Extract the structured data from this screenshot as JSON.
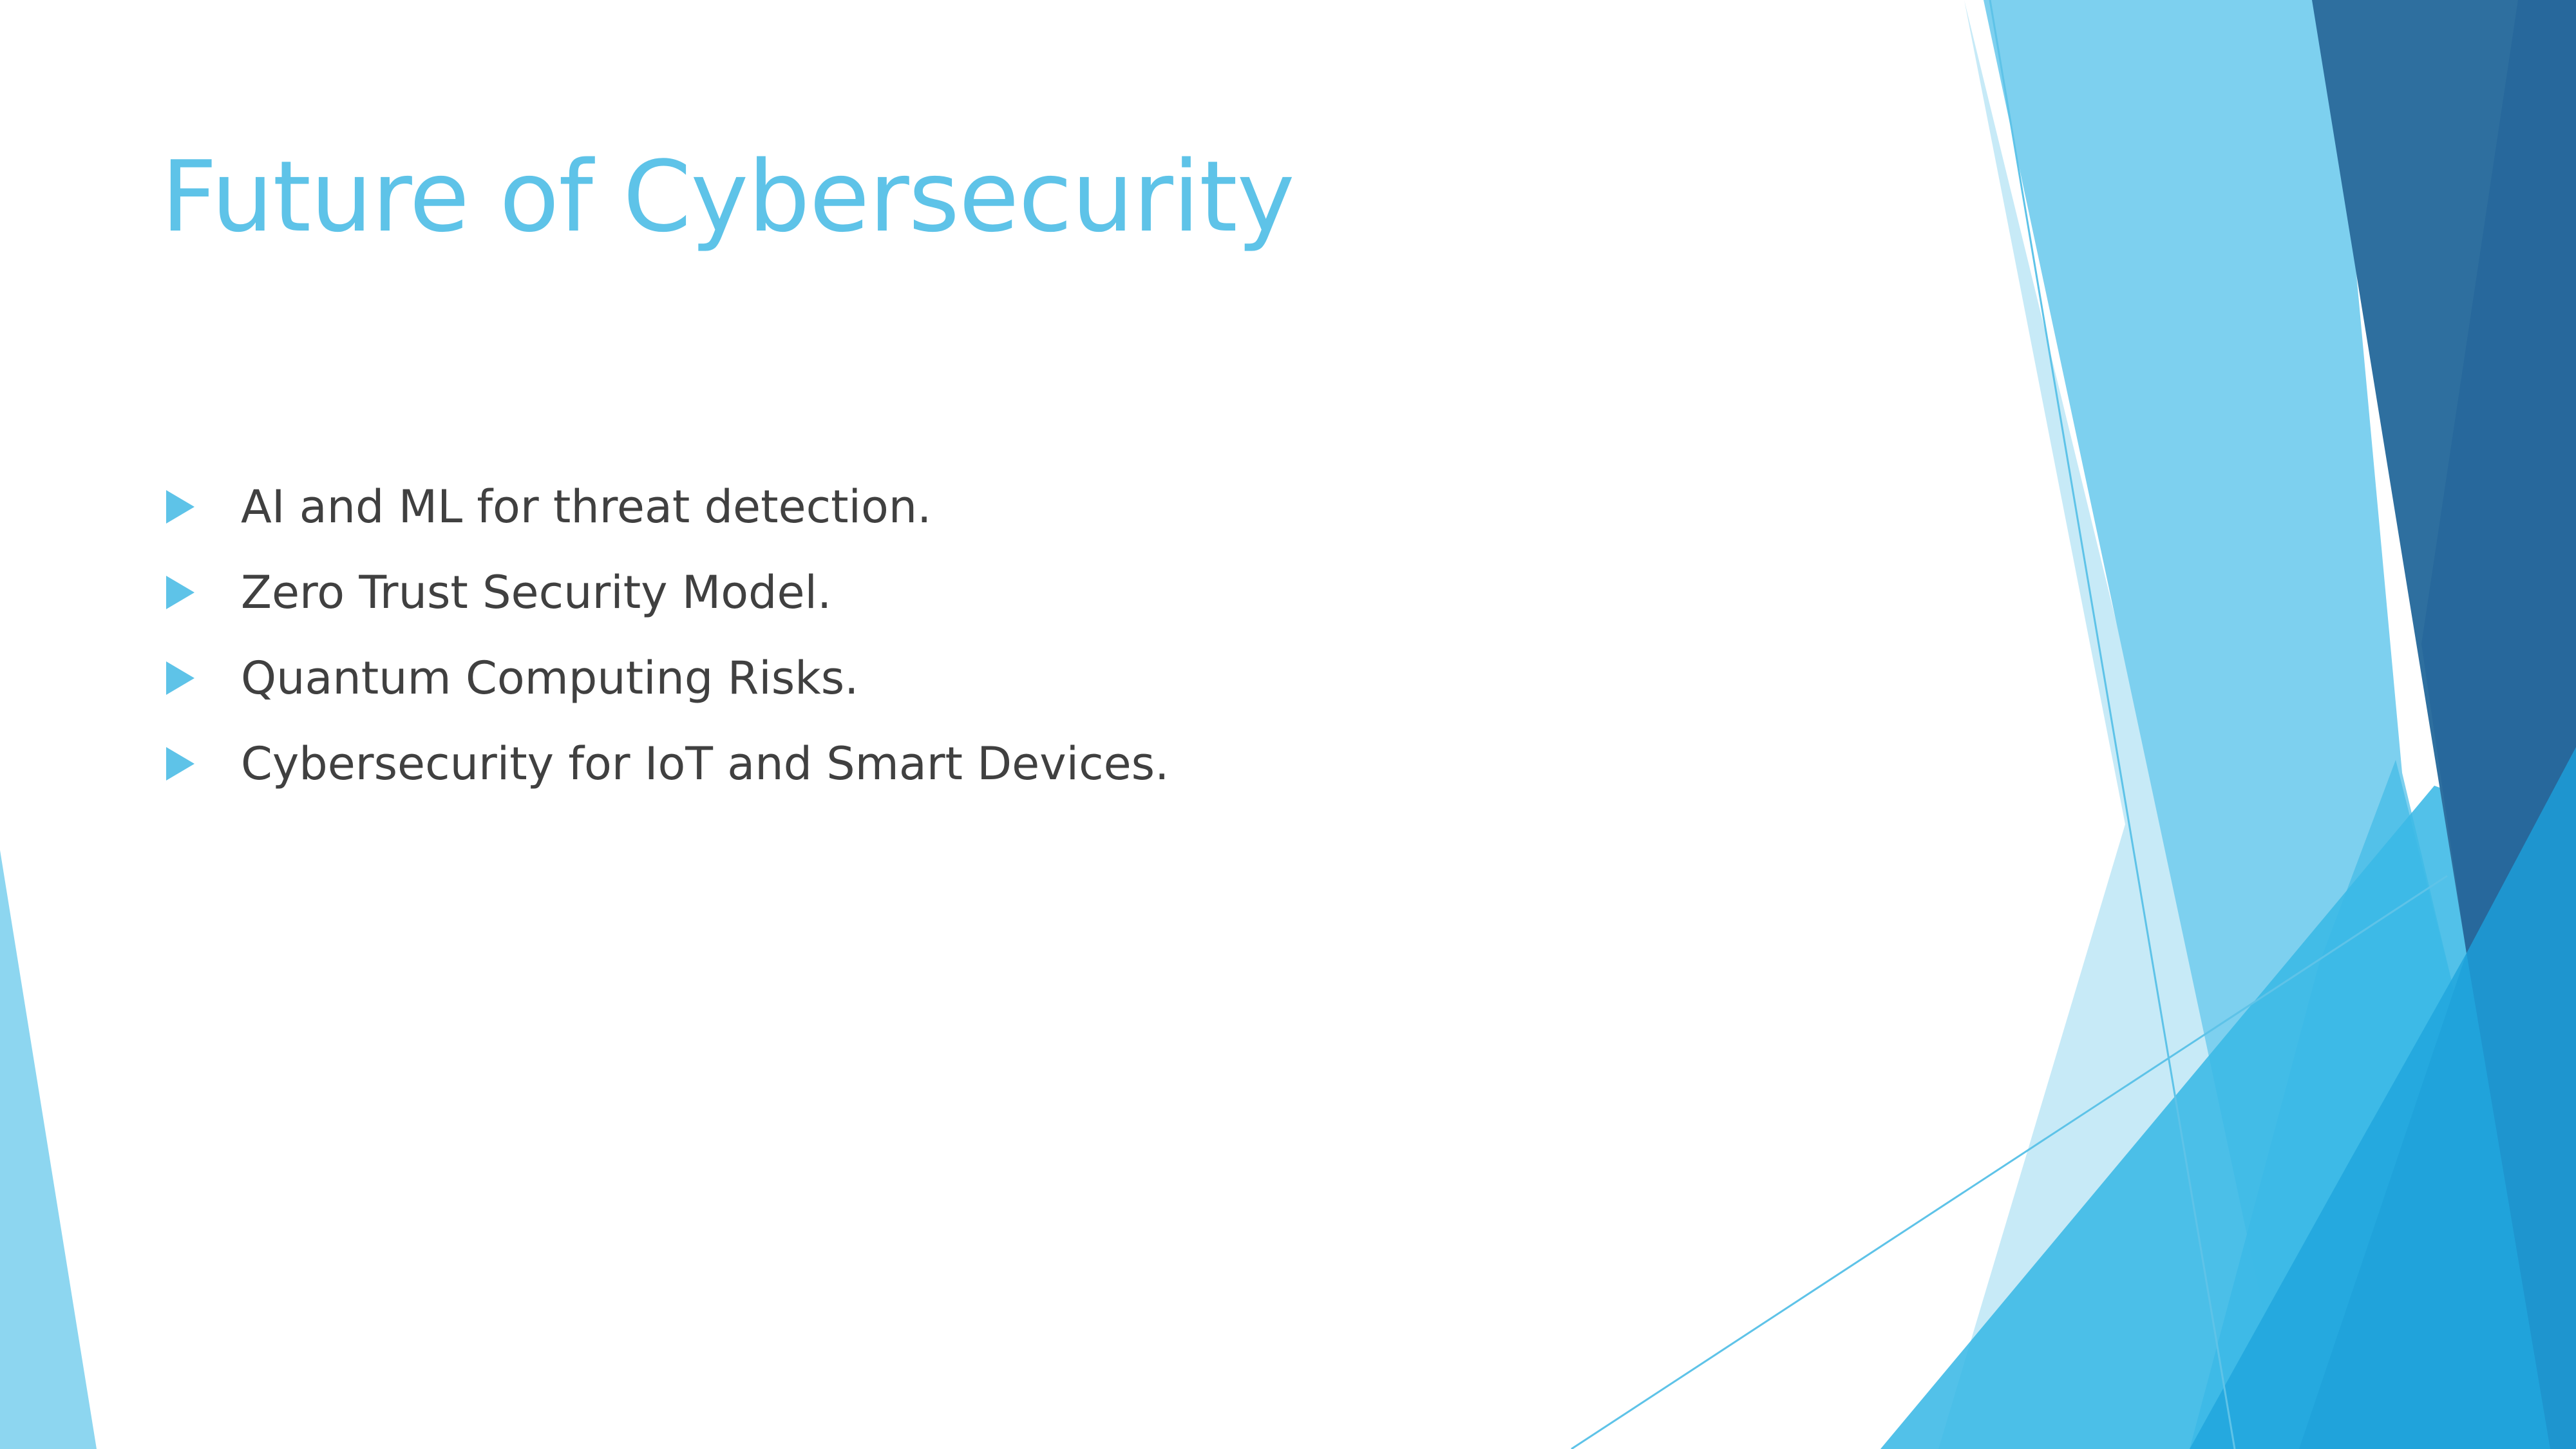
{
  "slide": {
    "title": "Future of Cybersecurity",
    "bullets": [
      "AI and ML for threat detection.",
      "Zero Trust Security Model.",
      "Quantum Computing Risks.",
      "Cybersecurity for IoT and Smart Devices."
    ]
  },
  "colors": {
    "title": "#5ec3e8",
    "body_text": "#404040",
    "bullet_icon": "#5ec3e8",
    "accent_light": "#7dd0ef",
    "accent_mid": "#2fb3e3",
    "accent_dark": "#2a6a9c"
  },
  "icons": {
    "bullet": "triangle-right-icon"
  }
}
